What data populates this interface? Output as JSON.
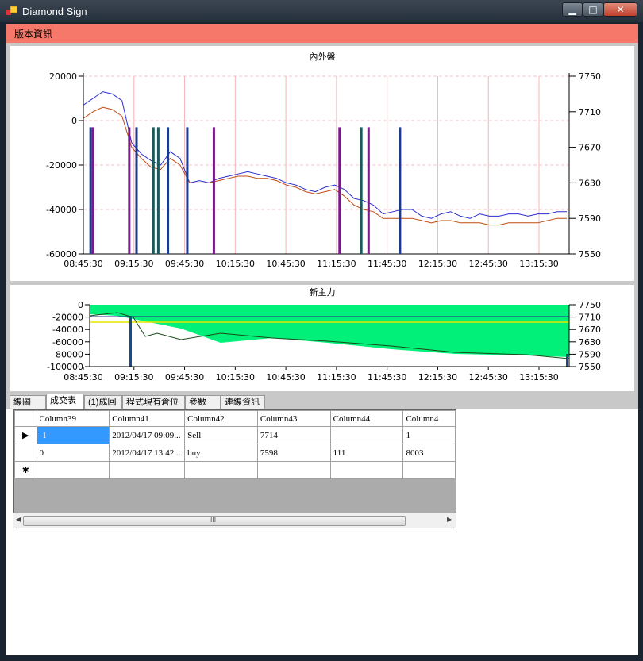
{
  "window": {
    "title": "Diamond Sign",
    "minimize": "▁",
    "maximize": "□",
    "close": "✕"
  },
  "menu": {
    "items": [
      "版本資訊"
    ]
  },
  "colors": {
    "menubar": "#f5786a",
    "selected_cell": "#3399ff",
    "flow_fill": "#00f07a",
    "inner_line": "#2a2ad0",
    "outer_line": "#c04a10"
  },
  "chart_data": [
    {
      "type": "line",
      "title": "內外盤",
      "x_ticks": [
        "08:45:30",
        "09:15:30",
        "09:45:30",
        "10:15:30",
        "10:45:30",
        "11:15:30",
        "11:45:30",
        "12:15:30",
        "12:45:30",
        "13:15:30"
      ],
      "y_left_ticks": [
        "20000",
        "0",
        "-20000",
        "-40000",
        "-60000"
      ],
      "y_right_ticks": [
        "7750",
        "7710",
        "7670",
        "7630",
        "7590",
        "7550"
      ],
      "ylim_left": [
        -60000,
        20000
      ],
      "ylim_right": [
        7550,
        7750
      ],
      "x_index": [
        0,
        0.2,
        0.4,
        0.6,
        0.8,
        1.0,
        1.2,
        1.4,
        1.6,
        1.8,
        2.0,
        2.2,
        2.4,
        2.6,
        2.8,
        3.0,
        3.2,
        3.4,
        3.6,
        3.8,
        4.0,
        4.2,
        4.4,
        4.6,
        4.8,
        5.0,
        5.2,
        5.4,
        5.6,
        5.8,
        6.0,
        6.2,
        6.4,
        6.6,
        6.8,
        7.0,
        7.2,
        7.4,
        7.6,
        7.8,
        8.0,
        8.2,
        8.4,
        8.6,
        8.8,
        9.0,
        9.2,
        9.4,
        9.6,
        9.8,
        10.0
      ],
      "series": [
        {
          "color": "#2a2ad0",
          "values": [
            7,
            10,
            13,
            12,
            9,
            -10,
            -15,
            -18,
            -20,
            -14,
            -17,
            -28,
            -27,
            -28,
            -26,
            -25,
            -24,
            -23,
            -24,
            -25,
            -26,
            -28,
            -29,
            -31,
            -32,
            -30,
            -29,
            -31,
            -35,
            -36,
            -38,
            -42,
            -41,
            -40,
            -40,
            -43,
            -44,
            -42,
            -41,
            -43,
            -44,
            -42,
            -43,
            -43,
            -42,
            -42,
            -43,
            -42,
            -42,
            -41,
            -41
          ]
        },
        {
          "color": "#c04a10",
          "values": [
            1,
            4,
            6,
            5,
            2,
            -12,
            -17,
            -21,
            -22,
            -17,
            -20,
            -28,
            -28,
            -28,
            -27,
            -26,
            -25,
            -25,
            -26,
            -26,
            -27,
            -29,
            -30,
            -32,
            -33,
            -32,
            -31,
            -34,
            -38,
            -40,
            -41,
            -44,
            -44,
            -44,
            -44,
            -45,
            -46,
            -45,
            -45,
            -46,
            -46,
            -46,
            -47,
            -47,
            -46,
            -46,
            -46,
            -46,
            -45,
            -44,
            -44
          ]
        }
      ]
    },
    {
      "type": "area",
      "title": "新主力",
      "x_ticks": [
        "08:45:30",
        "09:15:30",
        "09:45:30",
        "10:15:30",
        "10:45:30",
        "11:15:30",
        "11:45:30",
        "12:15:30",
        "12:45:30",
        "13:15:30"
      ],
      "y_left_ticks": [
        "0",
        "-20000",
        "-40000",
        "-60000",
        "-80000",
        "-100000"
      ],
      "y_right_ticks": [
        "7750",
        "7710",
        "7670",
        "7630",
        "7590",
        "7550"
      ],
      "ylim_left": [
        -100000,
        0
      ]
    }
  ],
  "tabs": [
    {
      "label": "線圖",
      "active": false
    },
    {
      "label": "成交表",
      "active": true
    },
    {
      "label": "(1)成回",
      "active": false
    },
    {
      "label": "程式現有倉位",
      "active": false
    },
    {
      "label": "參數",
      "active": false
    },
    {
      "label": "連線資訊",
      "active": false
    }
  ],
  "table": {
    "columns": [
      "Column39",
      "Column41",
      "Column42",
      "Column43",
      "Column44",
      "Column4"
    ],
    "rows": [
      {
        "marker": "▶",
        "cells": [
          "-1",
          "2012/04/17 09:09...",
          "Sell",
          "7714",
          "",
          "1"
        ]
      },
      {
        "marker": "",
        "cells": [
          "0",
          "2012/04/17 13:42...",
          "buy",
          "7598",
          "111",
          "8003"
        ]
      },
      {
        "marker": "✱",
        "cells": [
          "",
          "",
          "",
          "",
          "",
          ""
        ]
      }
    ]
  },
  "scrollbar": {
    "left": "◀",
    "right": "▶",
    "grip": "III"
  }
}
